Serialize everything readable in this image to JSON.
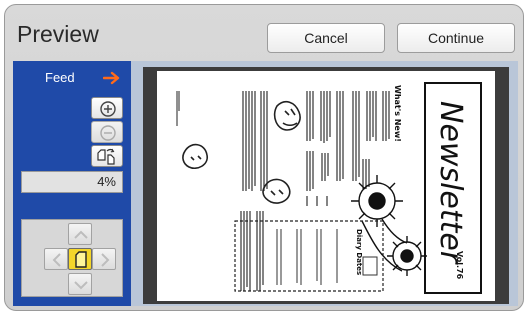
{
  "window": {
    "title": "Preview",
    "cancel_label": "Cancel",
    "continue_label": "Continue"
  },
  "sidebar": {
    "feed_label": "Feed",
    "zoom_value": "4%",
    "tools": [
      {
        "name": "zoom-in",
        "icon": "plus-circle-icon",
        "enabled": true
      },
      {
        "name": "zoom-out",
        "icon": "minus-circle-icon",
        "enabled": false
      },
      {
        "name": "rotate",
        "icon": "rotate-page-icon",
        "enabled": true
      }
    ],
    "dpad": {
      "up": "chevron-up-icon",
      "down": "chevron-down-icon",
      "left": "chevron-left-icon",
      "right": "chevron-right-icon",
      "center": "page-icon"
    }
  },
  "preview": {
    "headline": "Newsletter",
    "volume": "Vol.76",
    "heading_whats_new": "What's New!",
    "heading_diary": "Diary Dates"
  },
  "colors": {
    "sidebar_blue": "#1f4aa8",
    "feed_arrow": "#ff6a1a",
    "center_button": "#f4d62a",
    "preview_background": "#3c3c3c"
  }
}
